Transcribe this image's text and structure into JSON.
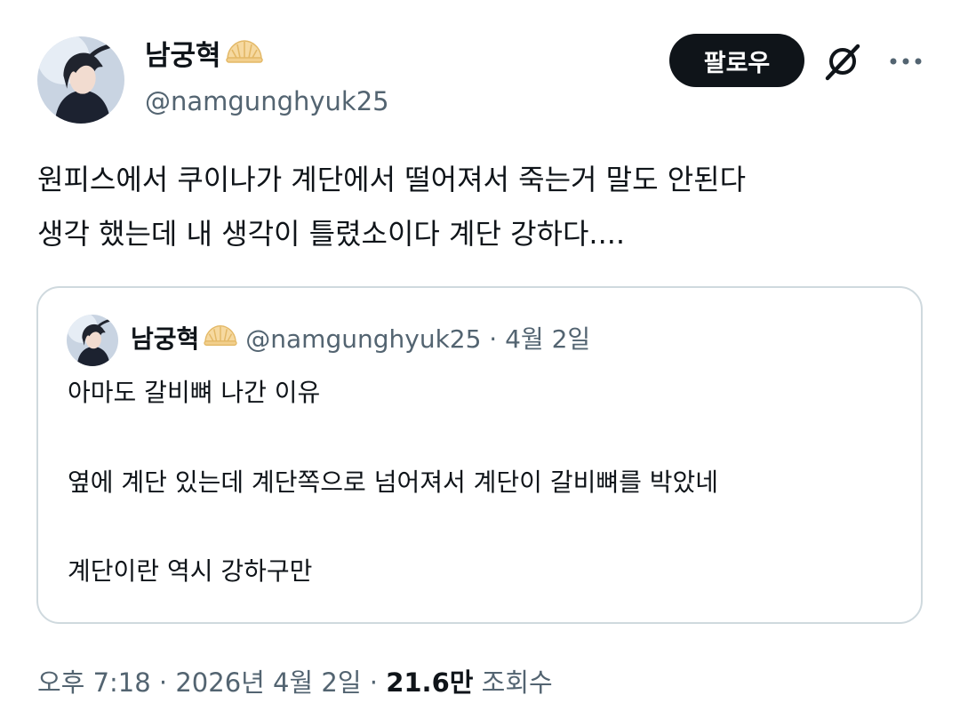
{
  "author": {
    "display_name": "남궁혁",
    "name_emoji": "bun-emoji",
    "handle": "@namgunghyuk25"
  },
  "actions": {
    "follow_label": "팔로우",
    "grok_icon": "grok-slash-icon",
    "more_icon": "more-dots-icon"
  },
  "tweet": {
    "lines": [
      "원피스에서 쿠이나가 계단에서 떨어져서 죽는거 말도 안된다",
      "생각 했는데  내 생각이 틀렸소이다 계단 강하다...."
    ]
  },
  "quote": {
    "display_name": "남궁혁",
    "meta": "@namgunghyuk25 · 4월 2일",
    "lines": [
      "아마도 갈비뼈 나간 이유",
      "옆에 계단 있는데 계단쪽으로 넘어져서 계단이 갈비뼈를 박았네",
      "계단이란 역시 강하구만"
    ]
  },
  "footer": {
    "timestamp": "오후 7:18 · 2026년 4월 2일 · ",
    "views_count": "21.6만",
    "views_label": " 조회수"
  },
  "colors": {
    "text": "#0f1419",
    "secondary": "#536471",
    "border": "#cfd9de",
    "button_bg": "#0f1419"
  }
}
